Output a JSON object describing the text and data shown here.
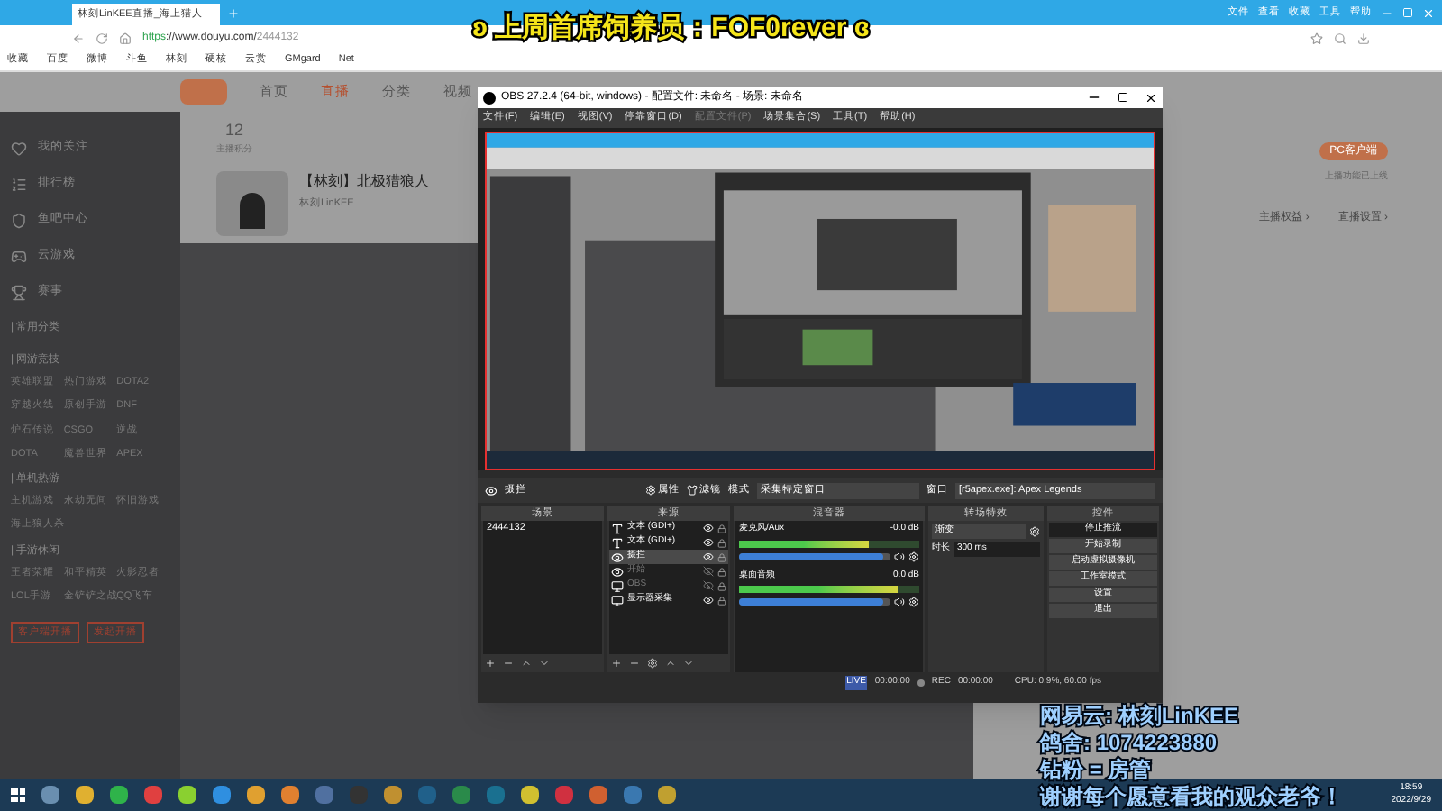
{
  "overlay": {
    "title": "ʚ 上周首席饲养员：FOF0rever ɞ",
    "lines": [
      "网易云: 林刻LinKEE",
      "鸽舍: 1074223880",
      "钻粉 = 房管",
      "谢谢每个愿意看我的观众老爷！"
    ]
  },
  "browser": {
    "tab_title": "林刻LinKEE直播_海上猎人",
    "url_scheme": "https",
    "url_rest": "://www.douyu.com/",
    "url_id": "2444132",
    "menu": [
      "文件",
      "查看",
      "收藏",
      "工具",
      "帮助"
    ],
    "bookmarks": [
      "收藏",
      "百度",
      "微博",
      "斗鱼",
      "林刻",
      "硬核",
      "云赏",
      "GMgard",
      "Net"
    ]
  },
  "douyu": {
    "nav": [
      {
        "label": "首页",
        "selected": false
      },
      {
        "label": "直播",
        "selected": true
      },
      {
        "label": "分类",
        "selected": false
      },
      {
        "label": "视频",
        "selected": false
      }
    ],
    "sidebar": {
      "items": [
        "我的关注",
        "排行榜",
        "鱼吧中心",
        "云游戏",
        "赛事"
      ],
      "sections": [
        {
          "title": "| 常用分类"
        },
        {
          "title": "| 网游竞技",
          "items": [
            "英雄联盟",
            "热门游戏",
            "DOTA2",
            "穿越火线",
            "原创手游",
            "DNF",
            "炉石传说",
            "CSGO",
            "逆战",
            "DOTA",
            "魔兽世界",
            "APEX"
          ]
        },
        {
          "title": "| 单机热游",
          "items": [
            "主机游戏",
            "永劫无间",
            "怀旧游戏",
            "海上狼人杀"
          ]
        },
        {
          "title": "| 手游休闲",
          "items": [
            "王者荣耀",
            "和平精英",
            "火影忍者",
            "LOL手游",
            "金铲铲之战",
            "QQ飞车"
          ]
        }
      ],
      "buttons": [
        "客户端开播",
        "发起开播"
      ]
    },
    "stats": [
      {
        "value": "12",
        "label": "主播积分"
      }
    ],
    "streamer": {
      "title": "【林刻】北极猎狼人",
      "name": "林刻LinKEE"
    },
    "right": {
      "pc_button": "PC客户端",
      "pc_note": "上播功能已上线",
      "links": [
        "主播权益 ›",
        "直播设置 ›"
      ]
    }
  },
  "obs": {
    "title": "OBS 27.2.4 (64-bit, windows) - 配置文件: 未命名 - 场景: 未命名",
    "menu": [
      {
        "label": "文件(F)",
        "disabled": false
      },
      {
        "label": "编辑(E)",
        "disabled": false
      },
      {
        "label": "视图(V)",
        "disabled": false
      },
      {
        "label": "停靠窗口(D)",
        "disabled": false
      },
      {
        "label": "配置文件(P)",
        "disabled": true
      },
      {
        "label": "场景集合(S)",
        "disabled": false
      },
      {
        "label": "工具(T)",
        "disabled": false
      },
      {
        "label": "帮助(H)",
        "disabled": false
      }
    ],
    "source_bar": {
      "name": "摄拦",
      "properties": "属性",
      "filters": "滤镜",
      "mode_label": "模式",
      "mode": "采集特定窗口",
      "window_label": "窗口",
      "window": "[r5apex.exe]: Apex Legends"
    },
    "docks": {
      "scenes": "场景",
      "sources": "来源",
      "mixer": "混音器",
      "transitions": "转场特效",
      "controls": "控件"
    },
    "scenes": [
      {
        "name": "2444132",
        "selected": false
      }
    ],
    "sources": [
      {
        "kind": "text",
        "name": "文本 (GDI+)",
        "visible": true,
        "selected": false
      },
      {
        "kind": "text",
        "name": "文本 (GDI+)",
        "visible": true,
        "selected": false
      },
      {
        "kind": "capture",
        "name": "摄拦",
        "visible": true,
        "selected": true
      },
      {
        "kind": "capture",
        "name": "开始",
        "visible": false,
        "selected": false
      },
      {
        "kind": "display",
        "name": "OBS",
        "visible": false,
        "selected": false
      },
      {
        "kind": "display",
        "name": "显示器采集",
        "visible": true,
        "selected": false
      }
    ],
    "mixer": [
      {
        "name": "麦克风/Aux",
        "reading": "-0.0 dB",
        "meter": {
          "level": 0.72
        },
        "fader": {
          "level": 0.95
        }
      },
      {
        "name": "桌面音频",
        "reading": "0.0 dB",
        "meter": {
          "level": 0.88
        },
        "fader": {
          "level": 0.95
        }
      }
    ],
    "transition": {
      "type": "渐变",
      "duration_label": "时长",
      "duration": "300 ms"
    },
    "controls": [
      {
        "label": "停止推流",
        "active": true
      },
      {
        "label": "开始录制",
        "active": false
      },
      {
        "label": "启动虚拟摄像机",
        "active": false
      },
      {
        "label": "工作室模式",
        "active": false
      },
      {
        "label": "设置",
        "active": false
      },
      {
        "label": "退出",
        "active": false
      }
    ],
    "status": {
      "live": "LIVE",
      "live_time": "00:00:00",
      "rec": "REC",
      "rec_time": "00:00:00",
      "cpu": "CPU: 0.9%, 60.00 fps"
    }
  },
  "taskbar": {
    "time": "18:59",
    "date": "2022/9/29"
  }
}
